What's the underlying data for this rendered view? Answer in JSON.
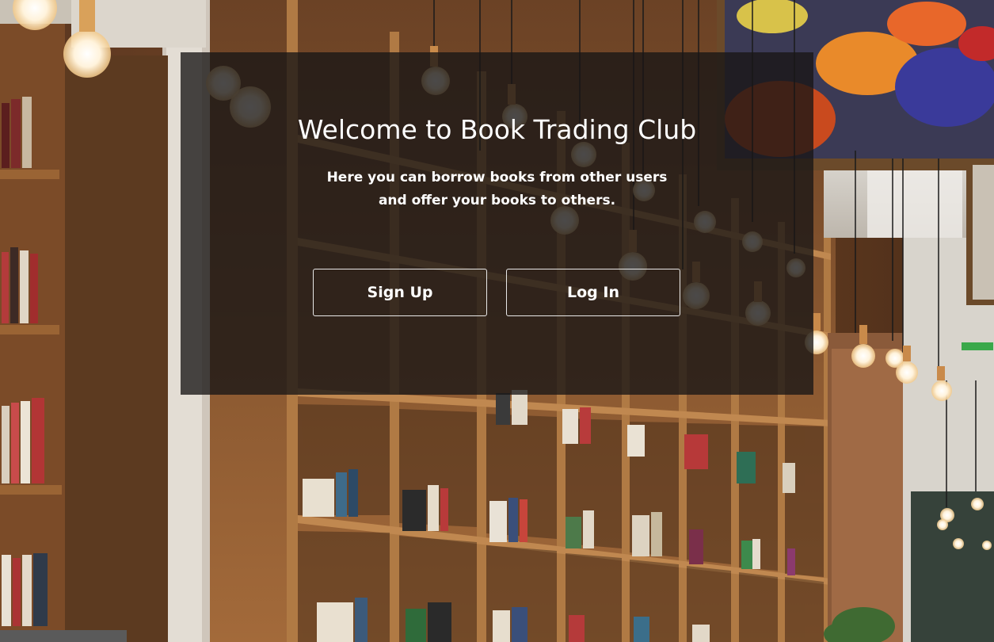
{
  "hero": {
    "title": "Welcome to Book Trading Club",
    "subtitle_line1": "Here you can borrow books from other users",
    "subtitle_line2": "and offer your books to others."
  },
  "actions": {
    "signup_label": "Sign Up",
    "login_label": "Log In"
  },
  "colors": {
    "overlay": "#181616",
    "text": "#ffffff",
    "button_border": "#e8e8e8",
    "wood": "#8a5a32"
  },
  "background": {
    "subject": "library-bookshelves-with-hanging-bulbs"
  }
}
